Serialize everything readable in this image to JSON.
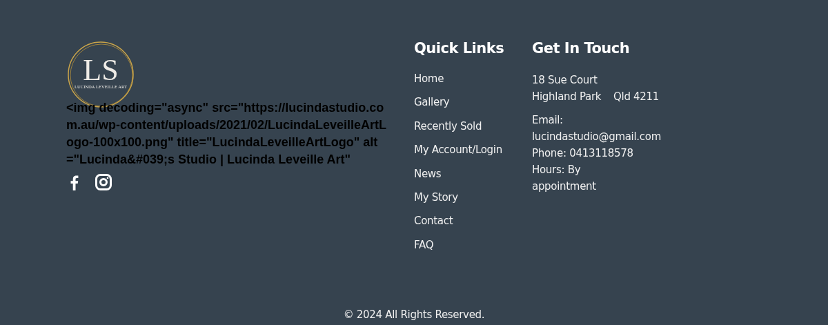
{
  "logo": {
    "initials": "LS",
    "tagline": "LUCINDA LEVEILLE ART"
  },
  "broken_image_text": "<img decoding=\"async\" src=\"https://lucindastudio.com.au/wp-content/uploads/2021/02/LucindaLeveilleArtLogo-100x100.png\" title=\"LucindaLeveilleArtLogo\" alt=\"Lucinda&#039;s Studio | Lucinda Leveille Art\"",
  "social": [
    {
      "kind": "facebook"
    },
    {
      "kind": "instagram"
    }
  ],
  "quick_links": {
    "title": "Quick Links",
    "items": [
      "Home",
      "Gallery",
      "Recently Sold",
      "My Account/Login",
      "News",
      "My Story",
      "Contact",
      "FAQ"
    ]
  },
  "contact": {
    "title": "Get In Touch",
    "address": [
      "18 Sue Court",
      "Highland Park    Qld 4211"
    ],
    "email_label": "Email:",
    "email": "lucindastudio@gmail.com",
    "phone": "Phone: 0413118578",
    "hours": "Hours: By appointment"
  },
  "copyright": "© 2024 All Rights Reserved."
}
